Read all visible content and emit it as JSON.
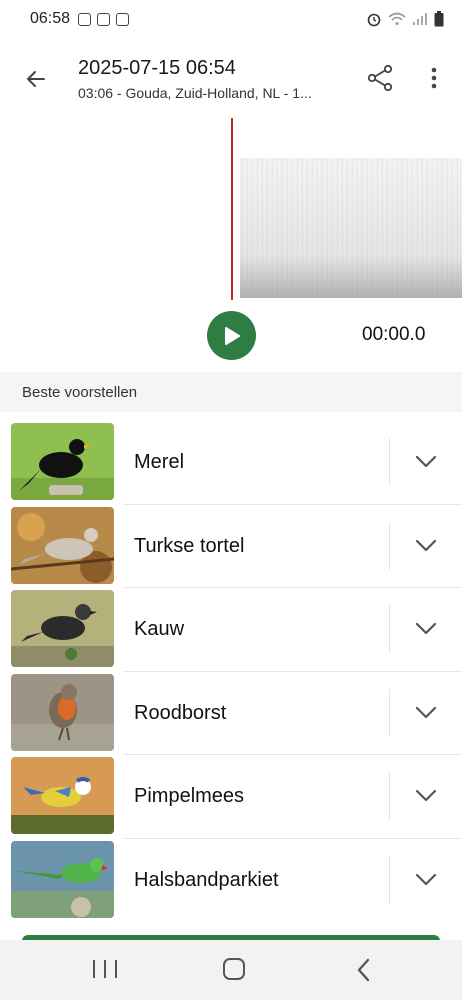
{
  "status_bar": {
    "time": "06:58"
  },
  "header": {
    "title": "2025-07-15 06:54",
    "subtitle": "03:06 - Gouda, Zuid-Holland, NL - 1..."
  },
  "player": {
    "elapsed": "00:00.0"
  },
  "suggestions": {
    "header": "Beste voorstellen",
    "items": [
      {
        "name": "Merel",
        "icon": "bird-photo"
      },
      {
        "name": "Turkse tortel",
        "icon": "bird-photo"
      },
      {
        "name": "Kauw",
        "icon": "bird-photo"
      },
      {
        "name": "Roodborst",
        "icon": "bird-photo"
      },
      {
        "name": "Pimpelmees",
        "icon": "bird-photo"
      },
      {
        "name": "Halsbandparkiet",
        "icon": "bird-photo"
      }
    ]
  },
  "colors": {
    "accent": "#2e7d43",
    "playhead": "#c62828"
  }
}
